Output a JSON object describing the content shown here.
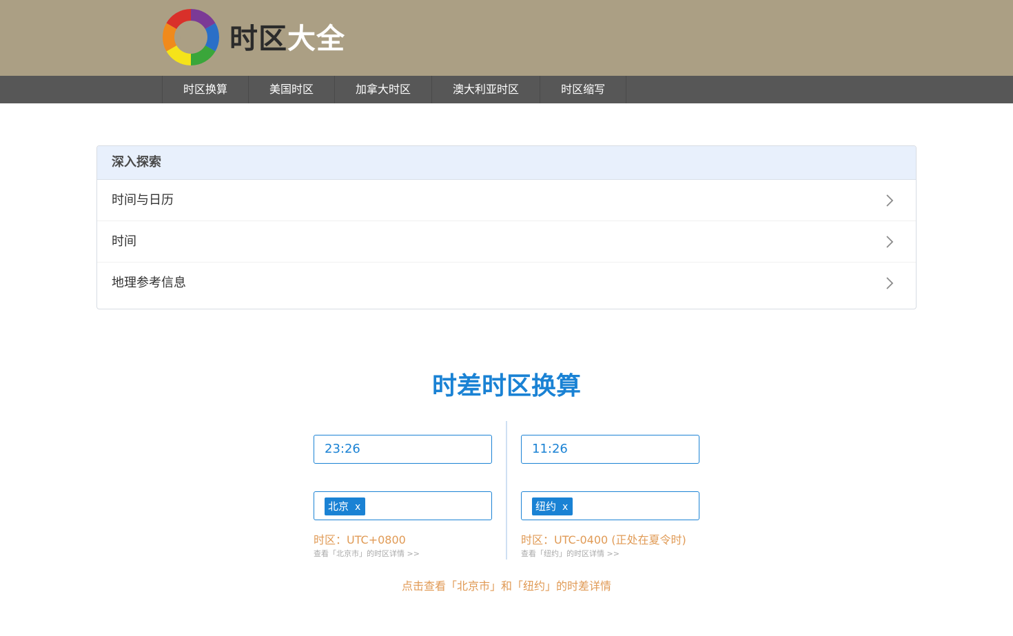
{
  "header": {
    "logo_text_dark": "时区",
    "logo_text_light": "大全"
  },
  "nav": {
    "items": [
      "时区换算",
      "美国时区",
      "加拿大时区",
      "澳大利亚时区",
      "时区缩写"
    ]
  },
  "explore": {
    "title": "深入探索",
    "items": [
      "时间与日历",
      "时间",
      "地理参考信息"
    ]
  },
  "converter": {
    "title": "时差时区换算",
    "left": {
      "time": "23:26",
      "city_tag": "北京",
      "remove_label": "x",
      "timezone": "时区：UTC+0800",
      "detail_link": "查看「北京市」的时区详情 >>"
    },
    "right": {
      "time": "11:26",
      "city_tag": "纽约",
      "remove_label": "x",
      "timezone": "时区：UTC-0400 (正处在夏令时)",
      "detail_link": "查看「纽约」的时区详情 >>"
    },
    "diff_link": "点击查看「北京市」和「纽约」的时差详情"
  },
  "colors": {
    "header_bg": "#ab9f84",
    "nav_bg": "#575757",
    "accent": "#1a82d4",
    "warning_text": "#e09a55",
    "panel_head_bg": "#e8f0fc"
  }
}
